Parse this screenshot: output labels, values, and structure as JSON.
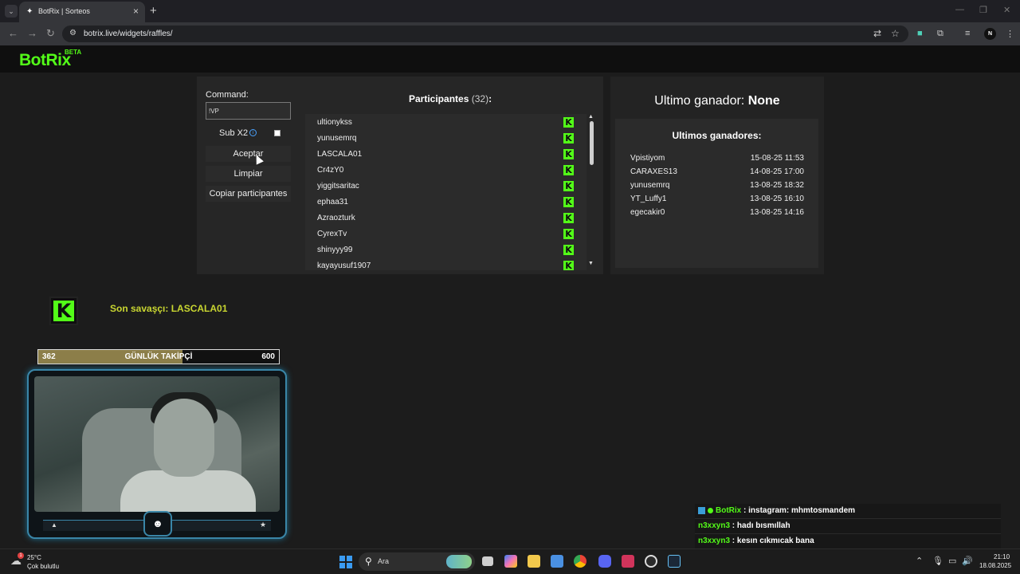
{
  "browser": {
    "tab_title": "BotRix | Sorteos",
    "url": "botrix.live/widgets/raffles/"
  },
  "site": {
    "logo": "BotRix",
    "logo_badge": "BETA"
  },
  "raffle": {
    "command_label": "Command:",
    "command_value": "!VP",
    "sub_label": "Sub X2",
    "sub_checked": false,
    "buttons": {
      "accept": "Aceptar",
      "clear": "Limpiar",
      "copy": "Copiar participantes"
    },
    "participants_label": "Participantes",
    "participants_count": "(32)",
    "participants_colon": ":",
    "participants": [
      "ultionykss",
      "yunusemrq",
      "LASCALA01",
      "Cr4zY0",
      "yiggitsaritac",
      "ephaa31",
      "Azraozturk",
      "CyrexTv",
      "shinyyy99",
      "kayayusuf1907"
    ],
    "last_winner_label": "Ultimo ganador:",
    "last_winner_value": "None",
    "recent_winners_title": "Ultimos ganadores:",
    "recent_winners": [
      {
        "name": "Vpistiyom",
        "date": "15-08-25 11:53"
      },
      {
        "name": "CARAXES13",
        "date": "14-08-25 17:00"
      },
      {
        "name": "yunusemrq",
        "date": "13-08-25 18:32"
      },
      {
        "name": "YT_Luffy1",
        "date": "13-08-25 16:10"
      },
      {
        "name": "egecakir0",
        "date": "13-08-25 14:16"
      }
    ]
  },
  "stream": {
    "last_fighter": "Son savaşçı: LASCALA01",
    "goal": {
      "current": "362",
      "title": "GÜNLÜK TAKİPÇİ",
      "target": "600",
      "progress_fraction": 0.6
    }
  },
  "chat": [
    {
      "user": "BotRix",
      "text": " : instagram: mhmtosmandem",
      "badges": true
    },
    {
      "user": "n3xxyn3",
      "text": " : hadı bısmıllah",
      "badges": false
    },
    {
      "user": "n3xxyn3",
      "text": " : kesın cıkmıcak bana",
      "badges": false
    }
  ],
  "taskbar": {
    "weather_temp": "25°C",
    "weather_desc": "Çok bulutlu",
    "weather_badge": "1",
    "search_text": "Ara",
    "time": "21:10",
    "date": "18.08.2025"
  },
  "colors": {
    "kick_green": "#53fc18",
    "accent_yellow": "#c9d631",
    "goal_fill": "#8c7e49"
  }
}
